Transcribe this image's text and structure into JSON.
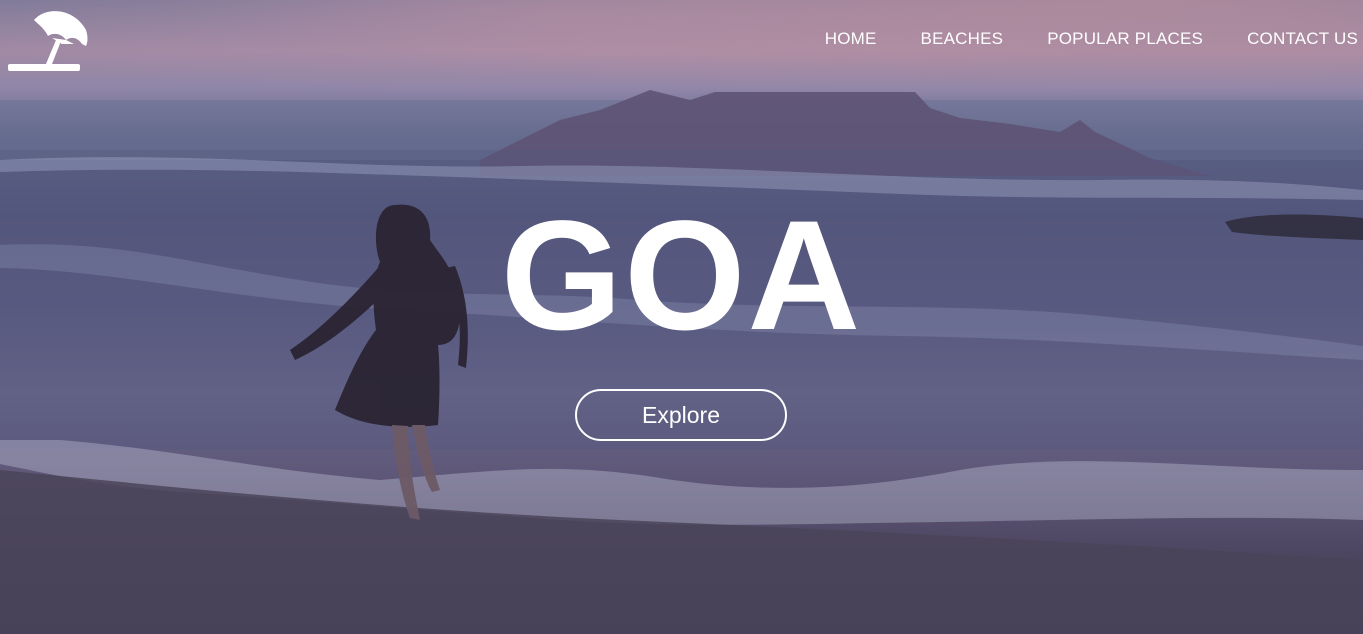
{
  "nav": {
    "items": [
      "HOME",
      "BEACHES",
      "POPULAR PLACES",
      "CONTACT US"
    ]
  },
  "logo": {
    "icon": "beach-umbrella-icon"
  },
  "hero": {
    "title": "GOA",
    "cta_label": "Explore"
  },
  "colors": {
    "text": "#ffffff",
    "sky": "#8f86a8",
    "sea": "#54557a",
    "sand": "#3f3a52"
  }
}
